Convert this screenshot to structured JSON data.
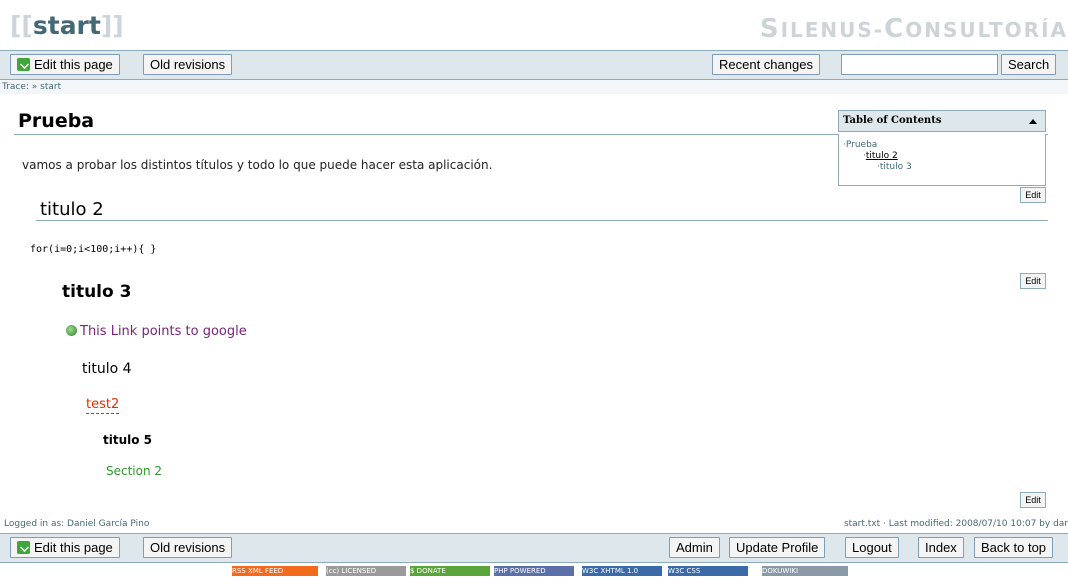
{
  "header": {
    "page_id": "start",
    "bracket_open": "[[",
    "bracket_close": "]]",
    "site_title_first": "S",
    "site_title_rest1": "ILENUS-",
    "site_title_c": "C",
    "site_title_rest2": "ONSULTORÍA"
  },
  "toolbar": {
    "edit_page": "Edit this page",
    "old_revisions": "Old revisions",
    "recent_changes": "Recent changes",
    "search_value": "",
    "search_button": "Search"
  },
  "trace": "Trace: » start",
  "content": {
    "title": "Prueba",
    "intro": "vamos a probar los distintos títulos y todo lo que puede hacer esta aplicación.",
    "h2": "titulo 2",
    "code": "for(i=0;i<100;i++){ }",
    "h3": "titulo 3",
    "ext_link": "This Link points to google",
    "h4": "titulo 4",
    "wiki_link": "test2",
    "h5": "titulo 5",
    "section_link": "Section 2",
    "edit_label": "Edit"
  },
  "toc": {
    "title": "Table of Contents",
    "items": [
      "Prueba",
      "titulo 2",
      "titulo 3"
    ]
  },
  "footer": {
    "logged_in": "Logged in as: Daniel García Pino",
    "last_modified": "start.txt · Last modified: 2008/07/10 10:07 by dar",
    "admin": "Admin",
    "update_profile": "Update Profile",
    "logout": "Logout",
    "index": "Index",
    "back_to_top": "Back to top"
  },
  "badges": [
    {
      "text": "RSS XML FEED",
      "color": "#f26b1d"
    },
    {
      "text": "(cc) LICENSED",
      "color": "#9a9a9a"
    },
    {
      "text": "$ DONATE",
      "color": "#5aa43c"
    },
    {
      "text": "PHP POWERED",
      "color": "#5b6fa8"
    },
    {
      "text": "W3C XHTML 1.0",
      "color": "#3a6aa8"
    },
    {
      "text": "W3C CSS",
      "color": "#3a6aa8"
    },
    {
      "text": "DOKUWIKI",
      "color": "#8a99a8"
    }
  ]
}
